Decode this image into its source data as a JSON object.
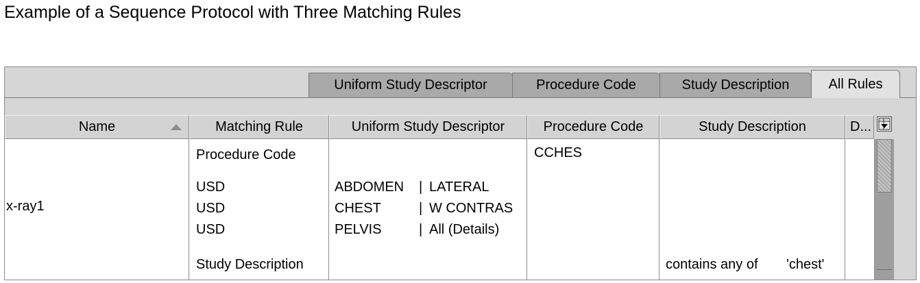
{
  "caption": "Example of a Sequence Protocol with Three Matching Rules",
  "tabs": [
    {
      "label": "Uniform Study Descriptor"
    },
    {
      "label": "Procedure Code"
    },
    {
      "label": "Study Description"
    },
    {
      "label": "All Rules"
    }
  ],
  "table": {
    "columns": [
      "Name",
      "Matching Rule",
      "Uniform Study Descriptor",
      "Procedure Code",
      "Study Description",
      "D..."
    ],
    "row": {
      "name": "x-ray1",
      "rules": [
        "Procedure Code",
        "USD",
        "USD",
        "USD",
        "Study Description"
      ],
      "usd": [
        {
          "body_part": "ABDOMEN",
          "sep": "|",
          "view": "LATERAL"
        },
        {
          "body_part": "CHEST",
          "sep": "|",
          "view": "W CONTRAS"
        },
        {
          "body_part": "PELVIS",
          "sep": "|",
          "view": "All (Details)"
        }
      ],
      "procedure_code": "CCHES",
      "study_description": {
        "op": "contains any of",
        "value": "'chest'"
      }
    }
  },
  "icons": {
    "column_control": "column-chooser-icon",
    "sort": "sort-ascending-icon"
  }
}
